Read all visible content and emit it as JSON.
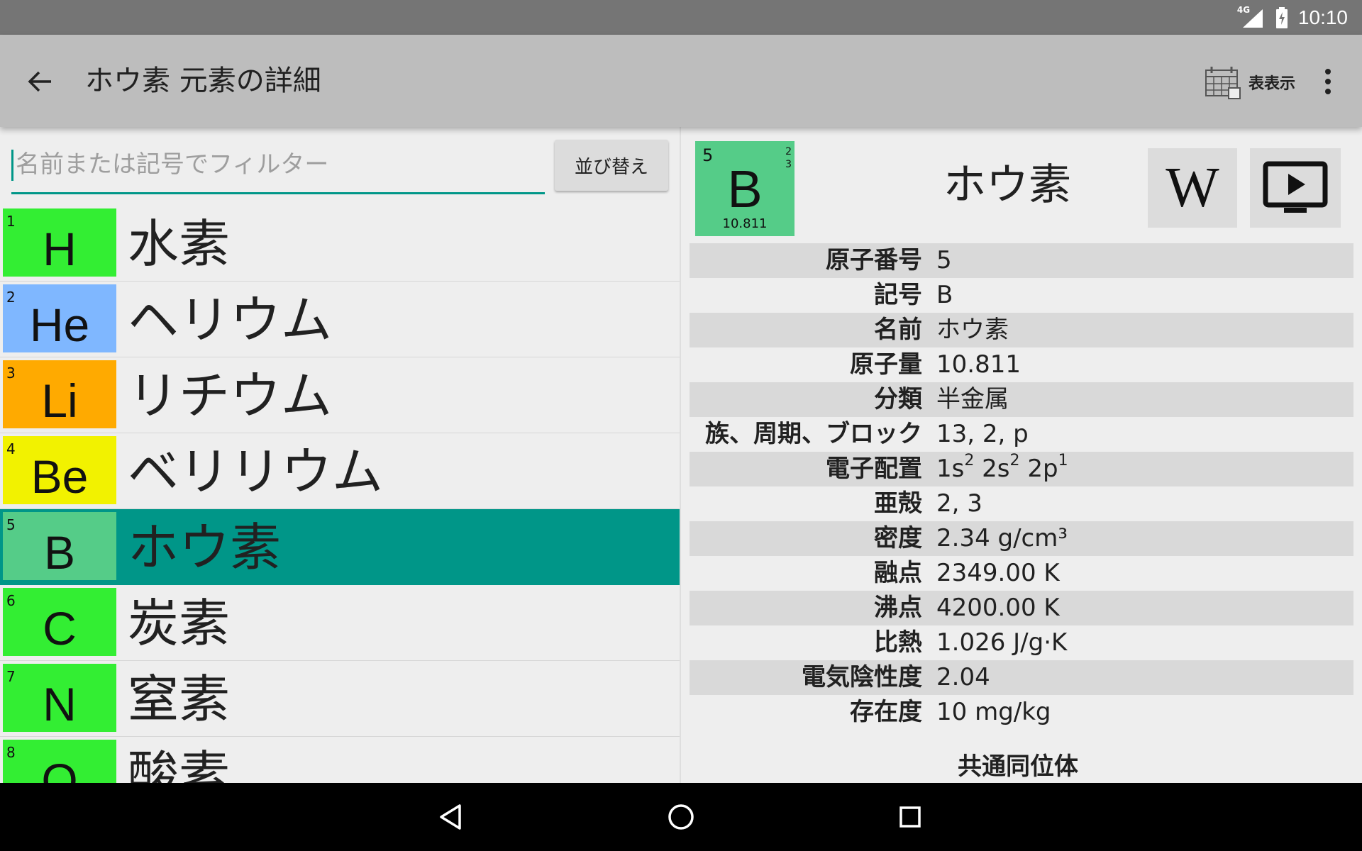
{
  "status_bar": {
    "time": "10:10",
    "network_label": "4G"
  },
  "app_bar": {
    "title": "ホウ素 元素の詳細",
    "table_view_label": "表表示"
  },
  "filter": {
    "placeholder": "名前または記号でフィルター",
    "value": ""
  },
  "sort_button_label": "並び替え",
  "elements": [
    {
      "number": "1",
      "symbol": "H",
      "name": "水素",
      "color": "#33ee33",
      "selected": false
    },
    {
      "number": "2",
      "symbol": "He",
      "name": "ヘリウム",
      "color": "#7fb7ff",
      "selected": false
    },
    {
      "number": "3",
      "symbol": "Li",
      "name": "リチウム",
      "color": "#ffaa00",
      "selected": false
    },
    {
      "number": "4",
      "symbol": "Be",
      "name": "ベリリウム",
      "color": "#f2f200",
      "selected": false
    },
    {
      "number": "5",
      "symbol": "B",
      "name": "ホウ素",
      "color": "#55cc88",
      "selected": true
    },
    {
      "number": "6",
      "symbol": "C",
      "name": "炭素",
      "color": "#33ee33",
      "selected": false
    },
    {
      "number": "7",
      "symbol": "N",
      "name": "窒素",
      "color": "#33ee33",
      "selected": false
    },
    {
      "number": "8",
      "symbol": "O",
      "name": "酸素",
      "color": "#33ee33",
      "selected": false
    }
  ],
  "detail": {
    "number": "5",
    "shells_top": "2",
    "shells_bottom": "3",
    "symbol": "B",
    "mass": "10.811",
    "name": "ホウ素",
    "tile_color": "#55cc88",
    "wiki_glyph": "W",
    "properties": [
      {
        "label": "原子番号",
        "value": "5"
      },
      {
        "label": "記号",
        "value": "B"
      },
      {
        "label": "名前",
        "value": "ホウ素"
      },
      {
        "label": "原子量",
        "value": "10.811"
      },
      {
        "label": "分類",
        "value": "半金属"
      },
      {
        "label": "族、周期、ブロック",
        "value": "13, 2, p"
      },
      {
        "label": "電子配置",
        "value": "",
        "config": [
          {
            "orb": "1s",
            "sup": "2"
          },
          {
            "orb": "2s",
            "sup": "2"
          },
          {
            "orb": "2p",
            "sup": "1"
          }
        ]
      },
      {
        "label": "亜殻",
        "value": "2, 3"
      },
      {
        "label": "密度",
        "value": "2.34 g/cm³"
      },
      {
        "label": "融点",
        "value": "2349.00 K"
      },
      {
        "label": "沸点",
        "value": "4200.00 K"
      },
      {
        "label": "比熱",
        "value": "1.026 J/g·K"
      },
      {
        "label": "電気陰性度",
        "value": "2.04"
      },
      {
        "label": "存在度",
        "value": "10 mg/kg"
      }
    ],
    "isotopes_title": "共通同位体"
  },
  "colors": {
    "accent": "#009688",
    "app_bar": "#bdbdbd",
    "status_bar": "#757575"
  }
}
